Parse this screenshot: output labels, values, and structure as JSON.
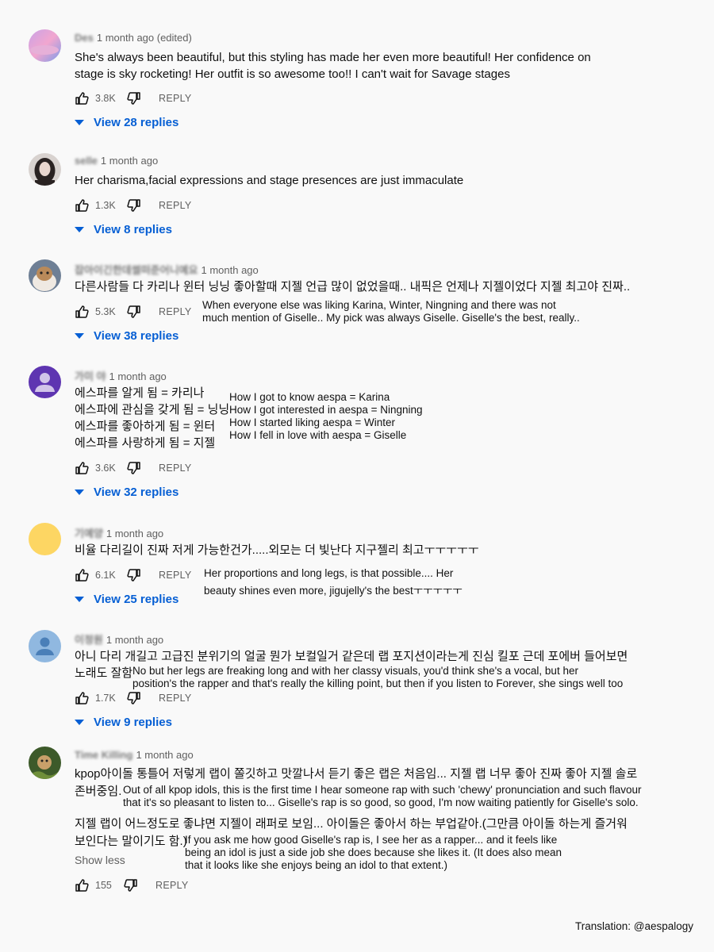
{
  "comments": [
    {
      "author": "Des",
      "time": "1 month ago (edited)",
      "lines": [
        "She's always been beautiful, but this styling has made her even more beautiful! Her confidence on",
        "stage is sky rocketing! Her outfit is so awesome too!! I can't wait for Savage stages"
      ],
      "likes": "3.8K",
      "reply_label": "REPLY",
      "replies": "View 28 replies"
    },
    {
      "author": "selle",
      "time": "1 month ago",
      "lines": [
        "Her charisma,facial expressions and stage presences are just immaculate"
      ],
      "likes": "1.3K",
      "reply_label": "REPLY",
      "replies": "View 8 replies"
    },
    {
      "author": "잡아이긴한데썰떠준어니예요",
      "time": "1 month ago",
      "lines": [
        "다른사람들 다 카리나 윈터 닝닝 좋아할때 지젤 언급 많이 없었을때.. 내픽은 언제나 지젤이었다 지젤 최고야 진짜.."
      ],
      "translation": [
        "When everyone else was liking Karina, Winter, Ningning and there was not",
        "much mention of Giselle.. My pick was always Giselle. Giselle's the best, really.."
      ],
      "likes": "5.3K",
      "reply_label": "REPLY",
      "replies": "View 38 replies"
    },
    {
      "author": "가미 야",
      "time": "1 month ago",
      "lines": [
        "에스파를 알게 됨 = 카리나",
        "에스파에 관심을 갖게 됨 = 닝닝",
        "에스파를 좋아하게 됨 = 윈터",
        "에스파를 사랑하게 됨 = 지젤"
      ],
      "translation": [
        "How I got to know aespa = Karina",
        "How I got interested in aespa = Ningning",
        "How I started liking aespa = Winter",
        "How I fell in love with aespa = Giselle"
      ],
      "likes": "3.6K",
      "reply_label": "REPLY",
      "replies": "View 32 replies"
    },
    {
      "author": "기예양",
      "time": "1 month ago",
      "lines": [
        "비율 다리길이 진짜 저게 가능한건가.....외모는 더 빛난다 지구젤리 최고ㅜㅜㅜㅜㅜ"
      ],
      "translation": [
        "Her proportions and long legs, is that possible.... Her",
        "beauty shines even more, jigujelly's the bestㅜㅜㅜㅜㅜ"
      ],
      "likes": "6.1K",
      "reply_label": "REPLY",
      "replies": "View 25 replies"
    },
    {
      "author": "이정원",
      "time": "1 month ago",
      "lines": [
        "아니 다리 개길고 고급진 분위기의 얼굴 뭔가 보컬일거 같은데 랩 포지션이라는게 진심 킬포 근데 포에버 들어보면",
        "노래도 잘함"
      ],
      "translation": [
        "No but her legs are freaking long and with her classy visuals, you'd think she's a vocal, but her",
        "position's the rapper and that's really the killing point, but then if you listen to Forever, she sings well too"
      ],
      "likes": "1.7K",
      "reply_label": "REPLY",
      "replies": "View 9 replies"
    },
    {
      "author": "Time Killing",
      "time": "1 month ago",
      "lines": [
        "kpop아이돌 통틀어 저렇게 랩이 쫄깃하고 맛깔나서 듣기 좋은 랩은 처음임... 지젤 랩 너무 좋아 진짜 좋아 지젤 솔로",
        "존버중임."
      ],
      "translation": [
        "Out of all kpop idols, this is the first time I hear someone rap with such 'chewy' pronunciation and such flavour",
        "that it's so pleasant to listen to... Giselle's rap is so good, so good, I'm now waiting patiently for Giselle's solo."
      ],
      "lines2": [
        "지젤 랩이 어느정도로 좋냐면 지젤이 래퍼로 보임... 아이돌은 좋아서 하는 부업같아.(그만큼 아이돌 하는게 즐거워",
        "보인다는 말이기도 함.)"
      ],
      "translation2": [
        "If you ask me how good Giselle's rap is, I see her as a rapper... and it feels like",
        "being an idol is just a side job she does because she likes it. (It does also mean",
        "that it looks like she enjoys being an idol to that extent.)"
      ],
      "show_less": "Show less",
      "likes": "155",
      "reply_label": "REPLY"
    }
  ],
  "credit": "Translation: @aespalogy",
  "colors": {
    "link": "#065fd4",
    "meta": "#606060",
    "background": "#f9f9f9"
  }
}
